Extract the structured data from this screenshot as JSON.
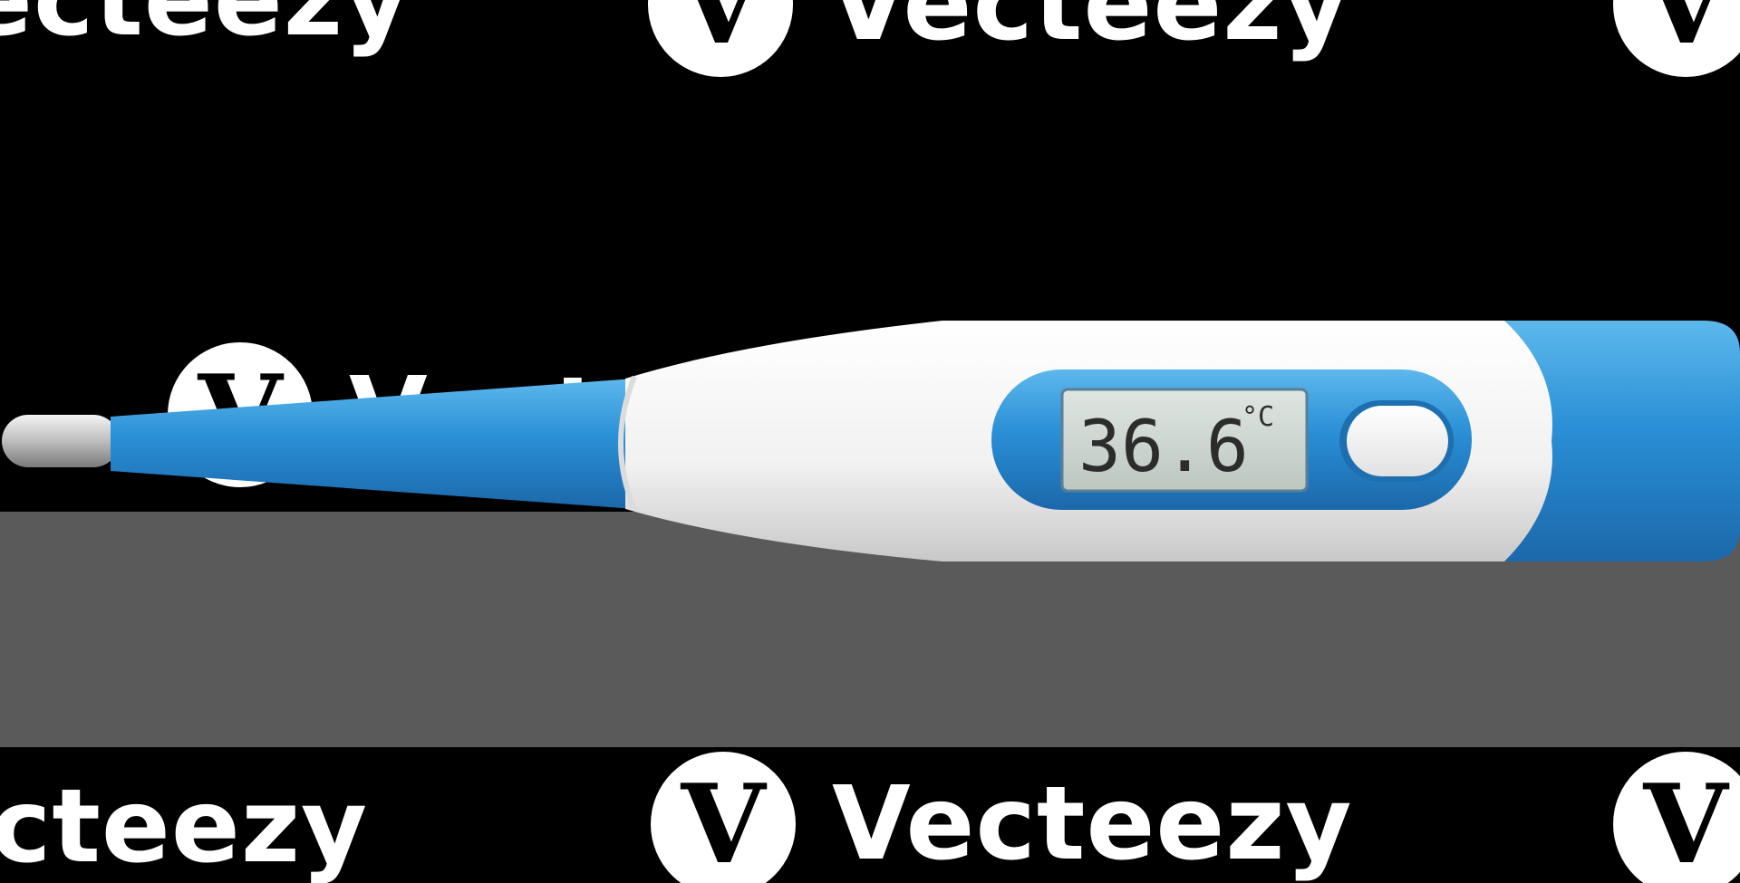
{
  "watermark": {
    "brand": "Vecteezy",
    "logo_glyph": "V",
    "partial_left": "cteezy",
    "partial_top_left": "ecteezy"
  },
  "thermometer": {
    "display_value": "36.6",
    "display_unit": "°C",
    "accent_color": "#2a8fd6",
    "body_color": "#f2f2f2",
    "lcd_color": "#c9d3cd"
  }
}
